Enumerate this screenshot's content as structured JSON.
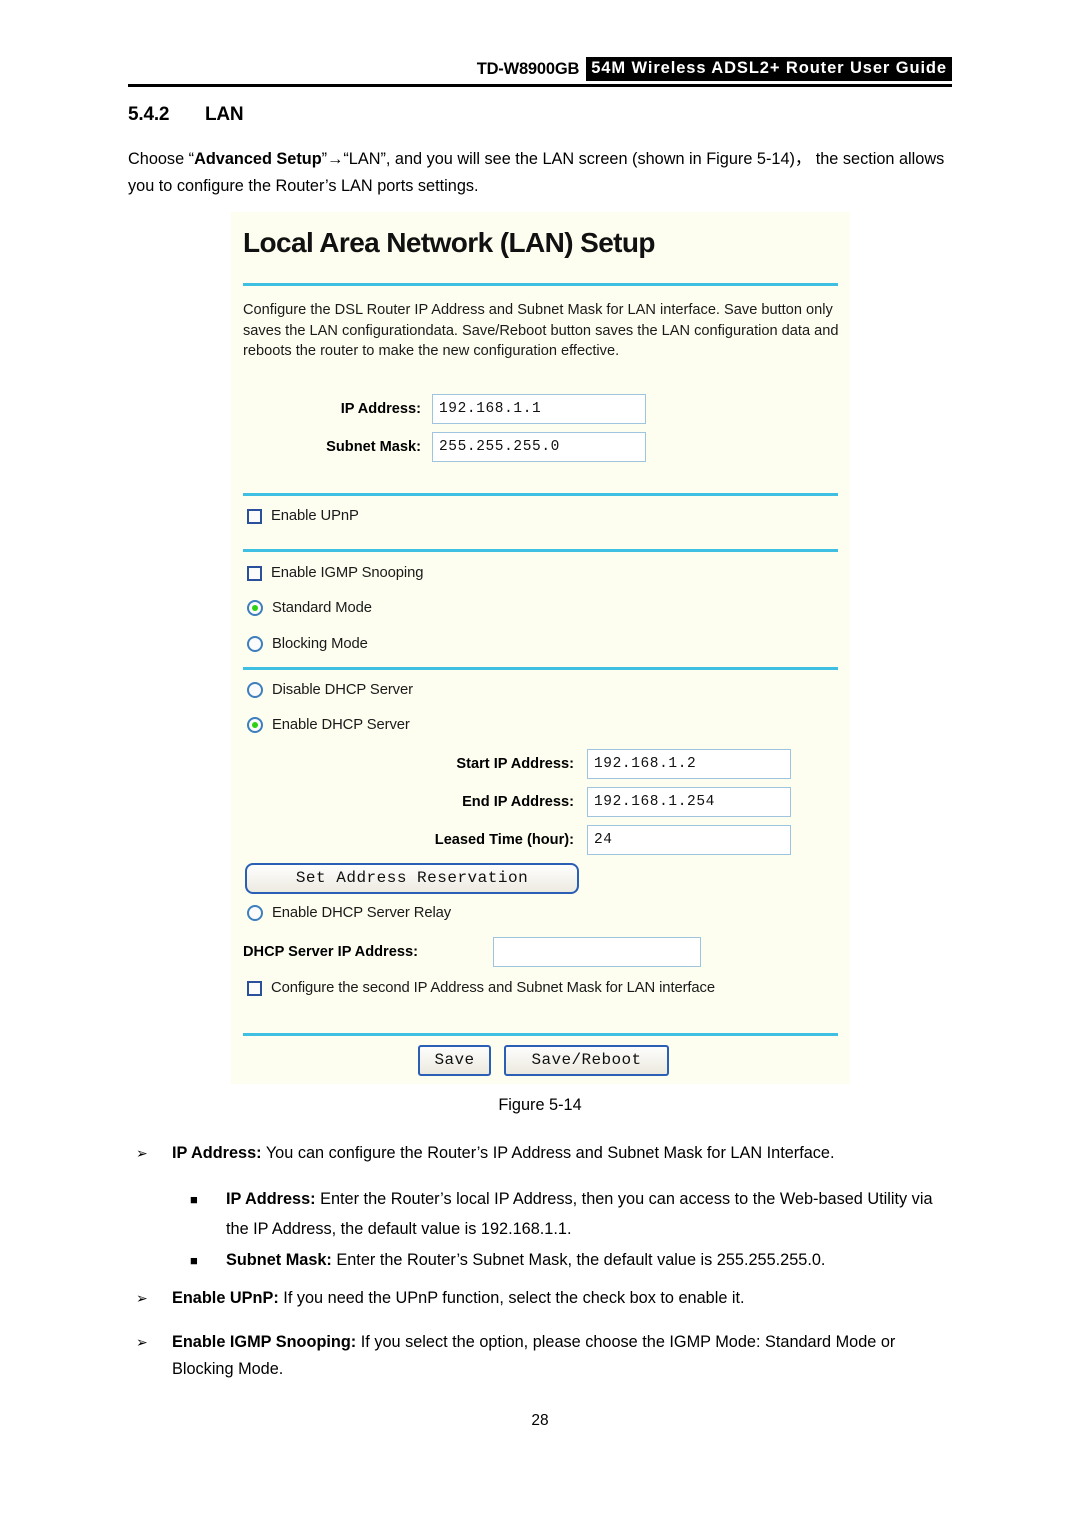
{
  "header": {
    "model": "TD-W8900GB",
    "guide_title": "54M Wireless ADSL2+ Router User Guide"
  },
  "section": {
    "number": "5.4.2",
    "title": "LAN",
    "intro_part1": "Choose “",
    "intro_bold1": "Advanced Setup",
    "intro_part2": "”→“LAN”, and you will see the LAN screen (shown in Figure 5-14)， the section allows you to configure the Router’s LAN ports settings."
  },
  "panel": {
    "title": "Local Area Network (LAN) Setup",
    "description": "Configure the DSL Router IP Address and Subnet Mask for LAN interface.  Save button only saves the LAN configurationdata.  Save/Reboot button saves the LAN configuration data and reboots the router to make the new configuration effective.",
    "fields": {
      "ip_address_label": "IP Address:",
      "ip_address_value": "192.168.1.1",
      "subnet_mask_label": "Subnet Mask:",
      "subnet_mask_value": "255.255.255.0",
      "start_ip_label": "Start IP Address:",
      "start_ip_value": "192.168.1.2",
      "end_ip_label": "End IP Address:",
      "end_ip_value": "192.168.1.254",
      "leased_time_label": "Leased Time (hour):",
      "leased_time_value": "24",
      "dhcp_server_ip_label": "DHCP Server IP Address:",
      "dhcp_server_ip_value": ""
    },
    "options": {
      "enable_upnp": "Enable UPnP",
      "enable_igmp_snooping": "Enable IGMP Snooping",
      "standard_mode": "Standard Mode",
      "blocking_mode": "Blocking Mode",
      "disable_dhcp_server": "Disable DHCP Server",
      "enable_dhcp_server": "Enable DHCP Server",
      "enable_dhcp_server_relay": "Enable DHCP Server Relay",
      "configure_second_ip": "Configure the second IP Address and Subnet Mask for LAN interface"
    },
    "buttons": {
      "set_address_reservation": "Set Address Reservation",
      "save": "Save",
      "save_reboot": "Save/Reboot"
    },
    "colors": {
      "panel_background": "#fdfdf0",
      "divider": "#3fc0e2",
      "radio_selected_dot": "#2fcf14",
      "control_border": "#2a5fb5",
      "input_border": "#9fc4de"
    }
  },
  "figure_caption": "Figure 5-14",
  "bullets": [
    {
      "marker": "➢",
      "bold": "IP Address:",
      "text": " You can configure the Router’s IP Address and Subnet Mask for LAN Interface."
    },
    {
      "marker": "■",
      "bold": "IP Address:",
      "text": " Enter the Router’s local IP Address, then you can access to the Web-based Utility via the IP Address, the default value is 192.168.1.1."
    },
    {
      "marker": "■",
      "bold": "Subnet Mask:",
      "text": " Enter the Router’s Subnet Mask, the default value is 255.255.255.0."
    },
    {
      "marker": "➢",
      "bold": "Enable UPnP:",
      "text": " If you need the UPnP function, select the check box to enable it."
    },
    {
      "marker": "➢",
      "bold": "Enable IGMP Snooping:",
      "text": " If you select the option, please choose the IGMP Mode: Standard Mode or Blocking Mode."
    }
  ],
  "page_number": "28"
}
